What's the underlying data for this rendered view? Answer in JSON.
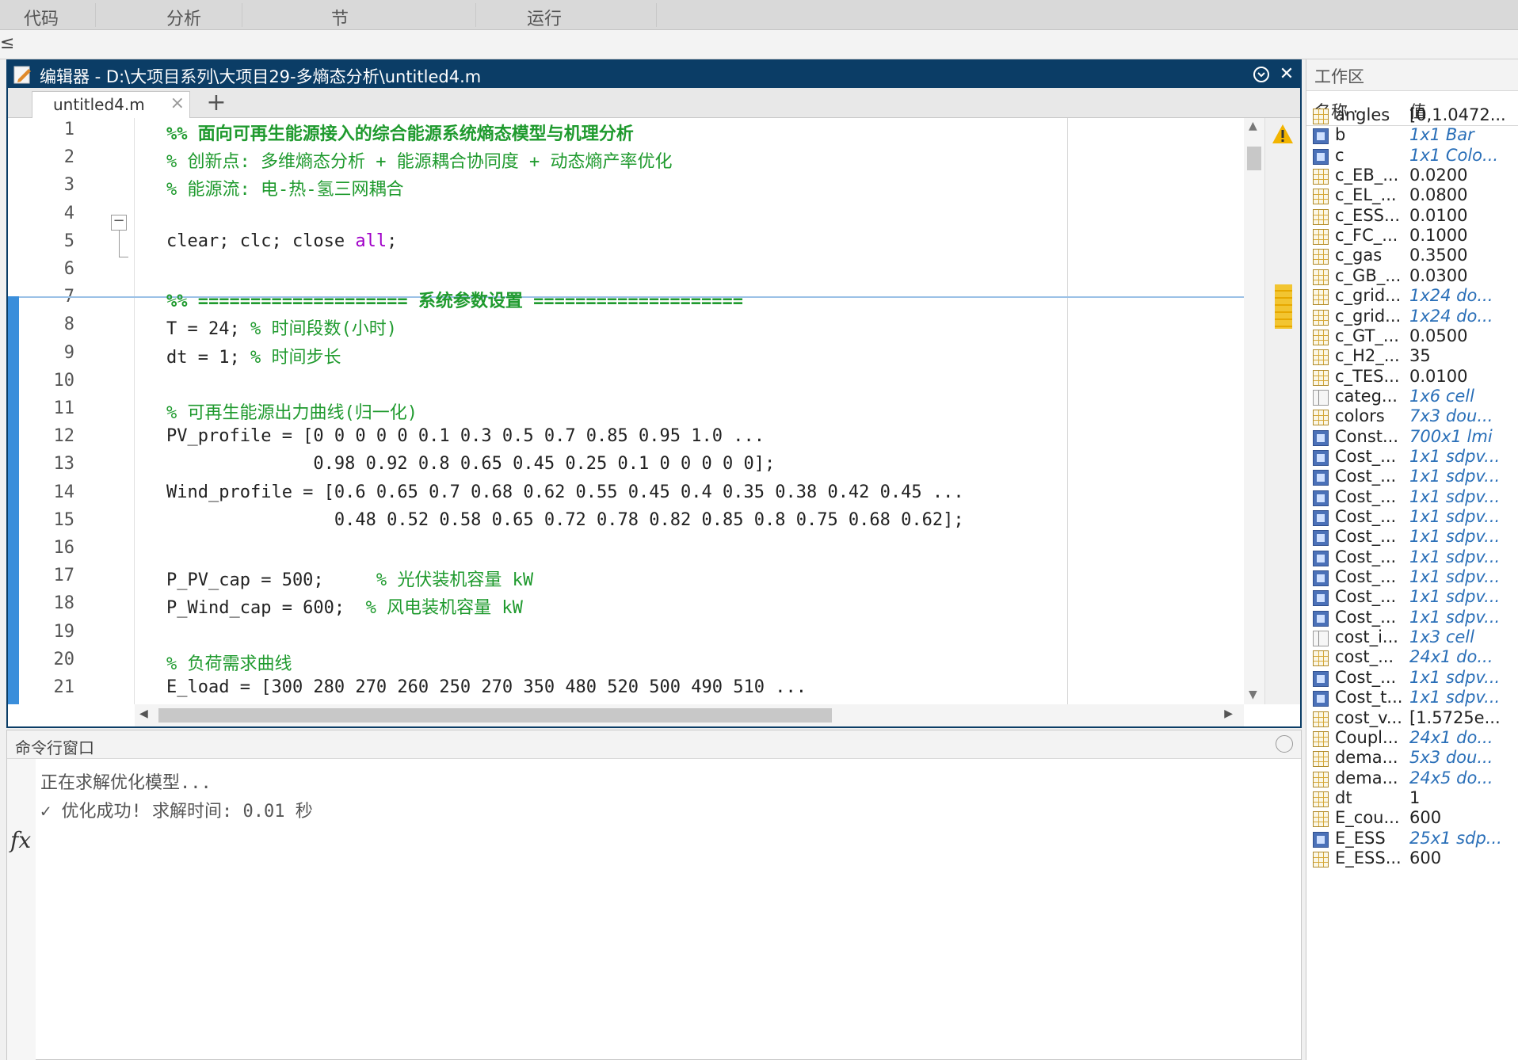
{
  "ribbon": {
    "tabs": [
      "代码",
      "分析",
      "节",
      "运行"
    ]
  },
  "address": {
    "crumb": "≤"
  },
  "editor": {
    "title": "编辑器 - D:\\大项目系列\\大项目29-多熵态分析\\untitled4.m",
    "tab_name": "untitled4.m",
    "tab_close": "×",
    "tab_add": "+",
    "lines": [
      {
        "n": "1",
        "t": "%% 面向可再生能源接入的综合能源系统熵态模型与机理分析"
      },
      {
        "n": "2",
        "t": "% 创新点: 多维熵态分析 + 能源耦合协同度 + 动态熵产率优化"
      },
      {
        "n": "3",
        "t": "% 能源流: 电-热-氢三网耦合"
      },
      {
        "n": "4",
        "t": ""
      },
      {
        "n": "5",
        "a": "clear; clc; close ",
        "b": "all",
        "c": ";"
      },
      {
        "n": "6",
        "t": ""
      },
      {
        "n": "7",
        "t": "%% ==================== 系统参数设置 ===================="
      },
      {
        "n": "8",
        "a": "T = 24; ",
        "b": "% 时间段数(小时)"
      },
      {
        "n": "9",
        "a": "dt = 1; ",
        "b": "% 时间步长"
      },
      {
        "n": "10",
        "t": ""
      },
      {
        "n": "11",
        "t": "% 可再生能源出力曲线(归一化)"
      },
      {
        "n": "12",
        "a": "PV_profile = [0 0 0 0 0 0.1 0.3 0.5 0.7 0.85 0.95 1.0 ..."
      },
      {
        "n": "13",
        "a": "              0.98 0.92 0.8 0.65 0.45 0.25 0.1 0 0 0 0 0];"
      },
      {
        "n": "14",
        "a": "Wind_profile = [0.6 0.65 0.7 0.68 0.62 0.55 0.45 0.4 0.35 0.38 0.42 0.45 ..."
      },
      {
        "n": "15",
        "a": "                0.48 0.52 0.58 0.65 0.72 0.78 0.82 0.85 0.8 0.75 0.68 0.62];"
      },
      {
        "n": "16",
        "t": ""
      },
      {
        "n": "17",
        "a": "P_PV_cap = 500;     ",
        "b": "% 光伏装机容量 kW"
      },
      {
        "n": "18",
        "a": "P_Wind_cap = 600;  ",
        "b": "% 风电装机容量 kW"
      },
      {
        "n": "19",
        "t": ""
      },
      {
        "n": "20",
        "t": "% 负荷需求曲线"
      },
      {
        "n": "21",
        "a": "E_load = [300 280 270 260 250 270 350 480 520 500 490 510 ..."
      }
    ]
  },
  "command_window": {
    "title": "命令行窗口",
    "lines": [
      "正在求解优化模型...",
      "✓ 优化成功! 求解时间: 0.01 秒"
    ],
    "prompt": "fx"
  },
  "workspace": {
    "title": "工作区",
    "col_name": "名称 ·",
    "col_value": "值",
    "vars": [
      {
        "name": "angles",
        "value": "[0,1.0472...",
        "icon": "grid",
        "italic": false
      },
      {
        "name": "b",
        "value": "1x1 Bar",
        "icon": "obj",
        "italic": true
      },
      {
        "name": "c",
        "value": "1x1 Colo...",
        "icon": "obj",
        "italic": true
      },
      {
        "name": "c_EB_...",
        "value": "0.0200",
        "icon": "grid",
        "italic": false
      },
      {
        "name": "c_EL_...",
        "value": "0.0800",
        "icon": "grid",
        "italic": false
      },
      {
        "name": "c_ESS...",
        "value": "0.0100",
        "icon": "grid",
        "italic": false
      },
      {
        "name": "c_FC_...",
        "value": "0.1000",
        "icon": "grid",
        "italic": false
      },
      {
        "name": "c_gas",
        "value": "0.3500",
        "icon": "grid",
        "italic": false
      },
      {
        "name": "c_GB_...",
        "value": "0.0300",
        "icon": "grid",
        "italic": false
      },
      {
        "name": "c_grid...",
        "value": "1x24 do...",
        "icon": "grid",
        "italic": true
      },
      {
        "name": "c_grid...",
        "value": "1x24 do...",
        "icon": "grid",
        "italic": true
      },
      {
        "name": "c_GT_...",
        "value": "0.0500",
        "icon": "grid",
        "italic": false
      },
      {
        "name": "c_H2_...",
        "value": "35",
        "icon": "grid",
        "italic": false
      },
      {
        "name": "c_TES...",
        "value": "0.0100",
        "icon": "grid",
        "italic": false
      },
      {
        "name": "categ...",
        "value": "1x6 cell",
        "icon": "cell",
        "italic": true
      },
      {
        "name": "colors",
        "value": "7x3 dou...",
        "icon": "grid",
        "italic": true
      },
      {
        "name": "Const...",
        "value": "700x1 lmi",
        "icon": "obj",
        "italic": true
      },
      {
        "name": "Cost_...",
        "value": "1x1 sdpv...",
        "icon": "obj",
        "italic": true
      },
      {
        "name": "Cost_...",
        "value": "1x1 sdpv...",
        "icon": "obj",
        "italic": true
      },
      {
        "name": "Cost_...",
        "value": "1x1 sdpv...",
        "icon": "obj",
        "italic": true
      },
      {
        "name": "Cost_...",
        "value": "1x1 sdpv...",
        "icon": "obj",
        "italic": true
      },
      {
        "name": "Cost_...",
        "value": "1x1 sdpv...",
        "icon": "obj",
        "italic": true
      },
      {
        "name": "Cost_...",
        "value": "1x1 sdpv...",
        "icon": "obj",
        "italic": true
      },
      {
        "name": "Cost_...",
        "value": "1x1 sdpv...",
        "icon": "obj",
        "italic": true
      },
      {
        "name": "Cost_...",
        "value": "1x1 sdpv...",
        "icon": "obj",
        "italic": true
      },
      {
        "name": "Cost_...",
        "value": "1x1 sdpv...",
        "icon": "obj",
        "italic": true
      },
      {
        "name": "cost_i...",
        "value": "1x3 cell",
        "icon": "cell",
        "italic": true
      },
      {
        "name": "cost_...",
        "value": "24x1 do...",
        "icon": "grid",
        "italic": true
      },
      {
        "name": "Cost_...",
        "value": "1x1 sdpv...",
        "icon": "obj",
        "italic": true
      },
      {
        "name": "Cost_t...",
        "value": "1x1 sdpv...",
        "icon": "obj",
        "italic": true
      },
      {
        "name": "cost_v...",
        "value": "[1.5725e...",
        "icon": "grid",
        "italic": false
      },
      {
        "name": "Coupl...",
        "value": "24x1 do...",
        "icon": "grid",
        "italic": true
      },
      {
        "name": "dema...",
        "value": "5x3 dou...",
        "icon": "grid",
        "italic": true
      },
      {
        "name": "dema...",
        "value": "24x5 do...",
        "icon": "grid",
        "italic": true
      },
      {
        "name": "dt",
        "value": "1",
        "icon": "grid",
        "italic": false
      },
      {
        "name": "E_cou...",
        "value": "600",
        "icon": "grid",
        "italic": false
      },
      {
        "name": "E_ESS",
        "value": "25x1 sdp...",
        "icon": "obj",
        "italic": true
      },
      {
        "name": "E_ESS...",
        "value": "600",
        "icon": "grid",
        "italic": false
      }
    ]
  },
  "colors": {
    "editor_title_bg": "#0b3d66",
    "comment": "#1f9a2e",
    "keyword": "#a000c8",
    "section_bar": "#3a8edb",
    "value_italic": "#2a6fb8"
  }
}
